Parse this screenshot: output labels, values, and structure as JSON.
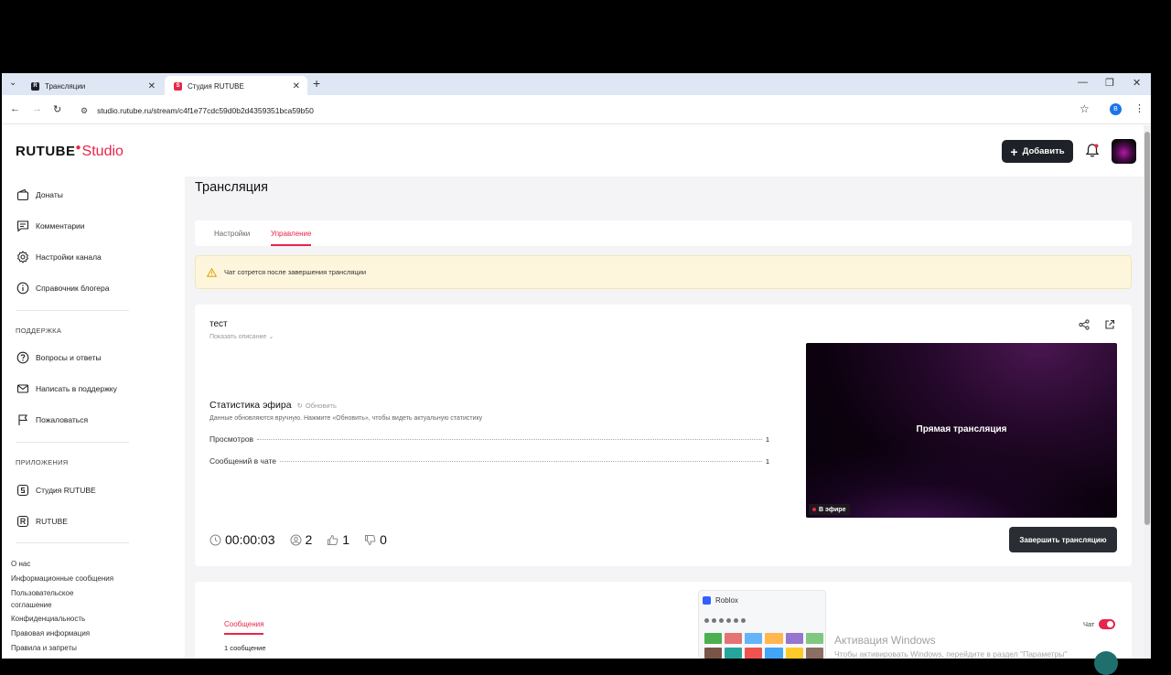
{
  "browser": {
    "tabs": [
      {
        "title": "Трансляции",
        "active": false
      },
      {
        "title": "Студия RUTUBE",
        "active": true
      }
    ],
    "url": "studio.rutube.ru/stream/c4f1e77cdc59d0b2d4359351bca59b50",
    "profile_initial": "B"
  },
  "header": {
    "logo_rutube": "RUTUBE",
    "logo_studio": "Studio",
    "add_button": "Добавить"
  },
  "sidebar": {
    "items": [
      {
        "label": "Донаты",
        "icon": "donate-icon"
      },
      {
        "label": "Комментарии",
        "icon": "comments-icon"
      },
      {
        "label": "Настройки канала",
        "icon": "settings-icon"
      },
      {
        "label": "Справочник блогера",
        "icon": "info-icon"
      }
    ],
    "support_heading": "ПОДДЕРЖКА",
    "support_items": [
      {
        "label": "Вопросы и ответы",
        "icon": "question-icon"
      },
      {
        "label": "Написать в поддержку",
        "icon": "mail-icon"
      },
      {
        "label": "Пожаловаться",
        "icon": "flag-icon"
      }
    ],
    "apps_heading": "ПРИЛОЖЕНИЯ",
    "apps_items": [
      {
        "label": "Студия RUTUBE",
        "icon": "studio-app-icon"
      },
      {
        "label": "RUTUBE",
        "icon": "rutube-app-icon"
      }
    ],
    "footer_links": [
      "О нас",
      "Информационные сообщения",
      "Пользовательское соглашение",
      "Конфиденциальность",
      "Правовая информация",
      "Правила и запреты"
    ]
  },
  "main": {
    "title": "Трансляция",
    "tabs": [
      "Настройки",
      "Управление"
    ],
    "active_tab": "Управление",
    "alert": "Чат сотрется после завершения трансляции",
    "stream_title": "тест",
    "show_description": "Показать описание",
    "stats_title": "Статистика эфира",
    "refresh_label": "Обновить",
    "stats_note": "Данные обновляются вручную. Нажмите «Обновить», чтобы видеть актуальную статистику",
    "stats": [
      {
        "label": "Просмотров",
        "value": "1"
      },
      {
        "label": "Сообщений в чате",
        "value": "1"
      }
    ],
    "player_text": "Прямая трансляция",
    "live_badge": "В эфире",
    "duration": "00:00:03",
    "viewers": "2",
    "likes": "1",
    "dislikes": "0",
    "end_button": "Завершить трансляцию"
  },
  "chat": {
    "tab": "Сообщения",
    "count": "1 сообщение",
    "chat_label": "Чат",
    "chat_enabled": true
  },
  "overlay": {
    "thumb_title": "Roblox",
    "activation_title": "Активация Windows",
    "activation_text": "Чтобы активировать Windows, перейдите в раздел \"Параметры\""
  },
  "colors": {
    "accent": "#e8254a",
    "dark_button": "#1e2128",
    "alert_bg": "#fdf6dc"
  }
}
